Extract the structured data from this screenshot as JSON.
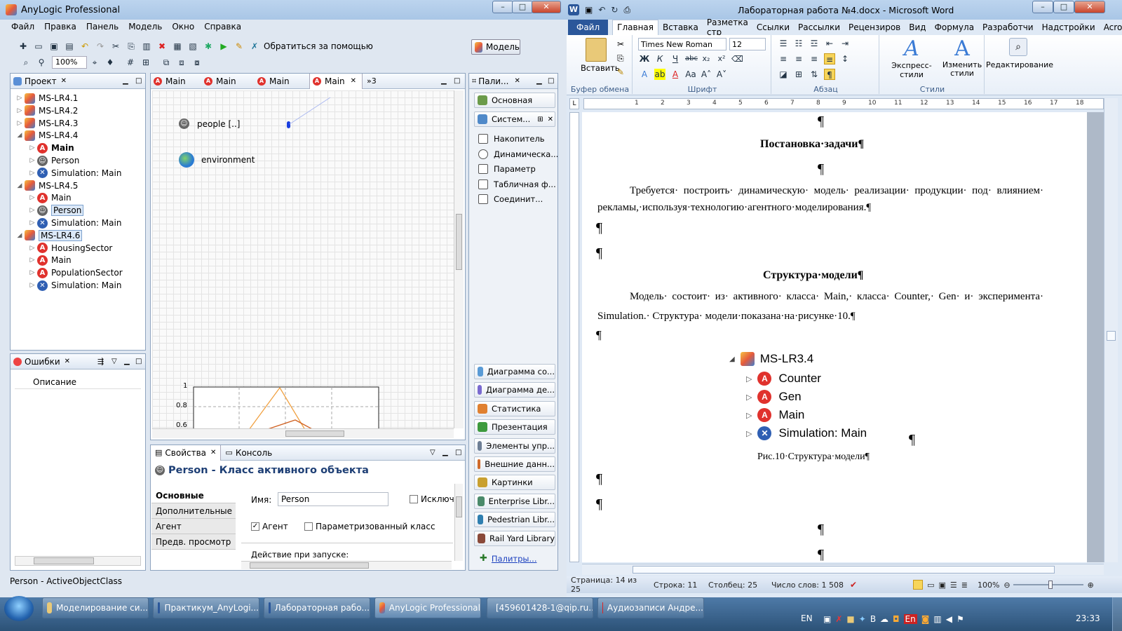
{
  "anylogic": {
    "title": "AnyLogic Professional",
    "menu": [
      "Файл",
      "Правка",
      "Панель",
      "Модель",
      "Окно",
      "Справка"
    ],
    "zoom": "100%",
    "help_label": "Обратиться за помощью",
    "model_button": "Модель",
    "project_tab": "Проект",
    "tree": [
      {
        "label": "MS-LR4.1",
        "type": "model",
        "level": 0,
        "expanded": false
      },
      {
        "label": "MS-LR4.2",
        "type": "model",
        "level": 0,
        "expanded": false
      },
      {
        "label": "MS-LR4.3",
        "type": "model",
        "level": 0,
        "expanded": false
      },
      {
        "label": "MS-LR4.4",
        "type": "model",
        "level": 0,
        "expanded": true
      },
      {
        "label": "Main",
        "type": "active",
        "level": 1,
        "bold": true
      },
      {
        "label": "Person",
        "type": "person",
        "level": 1
      },
      {
        "label": "Simulation: Main",
        "type": "sim",
        "level": 1
      },
      {
        "label": "MS-LR4.5",
        "type": "model",
        "level": 0,
        "expanded": true
      },
      {
        "label": "Main",
        "type": "active",
        "level": 1
      },
      {
        "label": "Person",
        "type": "person",
        "level": 1,
        "selected": true
      },
      {
        "label": "Simulation: Main",
        "type": "sim",
        "level": 1
      },
      {
        "label": "MS-LR4.6",
        "type": "model",
        "level": 0,
        "expanded": true,
        "selected": true
      },
      {
        "label": "HousingSector",
        "type": "active",
        "level": 1
      },
      {
        "label": "Main",
        "type": "active",
        "level": 1
      },
      {
        "label": "PopulationSector",
        "type": "active",
        "level": 1
      },
      {
        "label": "Simulation: Main",
        "type": "sim",
        "level": 1
      }
    ],
    "errors_tab": "Ошибки",
    "errors_col": "Описание",
    "editor_tabs": [
      "Main",
      "Main",
      "Main",
      "Main"
    ],
    "editor_more": "»3",
    "canvas": {
      "people": "people [..]",
      "environment": "environment"
    },
    "chart_ticks": [
      "1",
      "0.8",
      "0.6"
    ],
    "palette_tab": "Пали...",
    "palette_top": [
      "Основная",
      "Систем..."
    ],
    "palette_items": [
      "Накопитель",
      "Динамическа...",
      "Параметр",
      "Табличная ф...",
      "Соединит..."
    ],
    "palette_bottom": [
      "Диаграмма со...",
      "Диаграмма де...",
      "Статистика",
      "Презентация",
      "Элементы упр...",
      "Внешние данн...",
      "Картинки",
      "Enterprise Libr...",
      "Pedestrian Libr...",
      "Rail Yard Library"
    ],
    "palette_link": "Палитры...",
    "props_tab": "Свойства",
    "console_tab": "Консоль",
    "props_title": "Person - Класс активного объекта",
    "props_sections": [
      "Основные",
      "Дополнительные",
      "Агент",
      "Предв. просмотр"
    ],
    "name_label": "Имя:",
    "name_value": "Person",
    "exclude_label": "Исключи",
    "agent_label": "Агент",
    "param_class_label": "Параметризованный класс",
    "startup_label": "Действие при запуске:",
    "status": "Person - ActiveObjectClass"
  },
  "word": {
    "title": "Лабораторная работа №4.docx - Microsoft Word",
    "tabs": [
      "Файл",
      "Главная",
      "Вставка",
      "Разметка стр",
      "Ссылки",
      "Рассылки",
      "Рецензиров",
      "Вид",
      "Формула",
      "Разработчи",
      "Надстройки",
      "Acrobat"
    ],
    "paste_label": "Вставить",
    "clipboard_label": "Буфер обмена",
    "font_name": "Times New Roman",
    "font_size": "12",
    "font_group": "Шрифт",
    "para_group": "Абзац",
    "styles_group": "Стили",
    "express_styles": "Экспресс-стили",
    "change_styles": "Изменить стили",
    "editing": "Редактирование",
    "heading1": "Постановка·задачи¶",
    "para1_line1": "Требуется· построить· динамическую· модель· реализации· продукции· под· влиянием·",
    "para1_line2": "рекламы,·используя·технологию·агентного·моделирования.¶",
    "heading2": "Структура·модели¶",
    "para2_line1": "Модель· состоит· из· активного· класса· Main,· класса· Counter,· Gen· и· эксперимента·",
    "para2_line2": "Simulation.· Структура· модели·показана·на·рисунке·10.¶",
    "pilcrow": "¶",
    "fig_root": "MS-LR3.4",
    "fig_items": [
      "Counter",
      "Gen",
      "Main",
      "Simulation: Main"
    ],
    "caption": "Рис.10·Структура·модели¶",
    "ruler_marks": [
      "1",
      "2",
      "3",
      "4",
      "5",
      "6",
      "7",
      "8",
      "9",
      "10",
      "11",
      "12",
      "13",
      "14",
      "15",
      "16",
      "17",
      "18"
    ],
    "status_page": "Страница: 14 из 25",
    "status_line": "Строка: 11",
    "status_col": "Столбец: 25",
    "status_words": "Число слов: 1 508",
    "zoom": "100%"
  },
  "taskbar": {
    "items": [
      "Моделирование си...",
      "Практикум_AnyLogi...",
      "Лабораторная рабо...",
      "AnyLogic Professional",
      "[459601428-1@qip.ru...",
      "Аудиозаписи Андре..."
    ],
    "lang": "EN",
    "clock": "23:33"
  }
}
